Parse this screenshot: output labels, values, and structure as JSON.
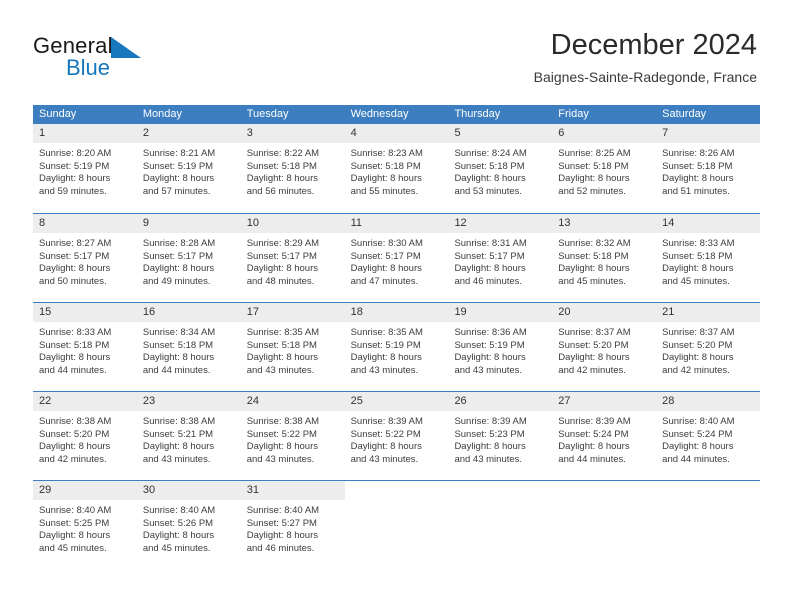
{
  "logo": {
    "word_one": "General",
    "word_two": "Blue",
    "mark": "triangle-icon",
    "color_dark": "#1a1a1a",
    "color_blue": "#1878be"
  },
  "header": {
    "title": "December 2024",
    "subtitle": "Baignes-Sainte-Radegonde, France"
  },
  "theme": {
    "header_blue": "#3c7ebf",
    "day_band_gray": "#ededed",
    "text": "#333333"
  },
  "weekday_headers": [
    "Sunday",
    "Monday",
    "Tuesday",
    "Wednesday",
    "Thursday",
    "Friday",
    "Saturday"
  ],
  "weeks": [
    [
      {
        "day": "1",
        "sunrise": "Sunrise: 8:20 AM",
        "sunset": "Sunset: 5:19 PM",
        "daylight_1": "Daylight: 8 hours",
        "daylight_2": "and 59 minutes."
      },
      {
        "day": "2",
        "sunrise": "Sunrise: 8:21 AM",
        "sunset": "Sunset: 5:19 PM",
        "daylight_1": "Daylight: 8 hours",
        "daylight_2": "and 57 minutes."
      },
      {
        "day": "3",
        "sunrise": "Sunrise: 8:22 AM",
        "sunset": "Sunset: 5:18 PM",
        "daylight_1": "Daylight: 8 hours",
        "daylight_2": "and 56 minutes."
      },
      {
        "day": "4",
        "sunrise": "Sunrise: 8:23 AM",
        "sunset": "Sunset: 5:18 PM",
        "daylight_1": "Daylight: 8 hours",
        "daylight_2": "and 55 minutes."
      },
      {
        "day": "5",
        "sunrise": "Sunrise: 8:24 AM",
        "sunset": "Sunset: 5:18 PM",
        "daylight_1": "Daylight: 8 hours",
        "daylight_2": "and 53 minutes."
      },
      {
        "day": "6",
        "sunrise": "Sunrise: 8:25 AM",
        "sunset": "Sunset: 5:18 PM",
        "daylight_1": "Daylight: 8 hours",
        "daylight_2": "and 52 minutes."
      },
      {
        "day": "7",
        "sunrise": "Sunrise: 8:26 AM",
        "sunset": "Sunset: 5:18 PM",
        "daylight_1": "Daylight: 8 hours",
        "daylight_2": "and 51 minutes."
      }
    ],
    [
      {
        "day": "8",
        "sunrise": "Sunrise: 8:27 AM",
        "sunset": "Sunset: 5:17 PM",
        "daylight_1": "Daylight: 8 hours",
        "daylight_2": "and 50 minutes."
      },
      {
        "day": "9",
        "sunrise": "Sunrise: 8:28 AM",
        "sunset": "Sunset: 5:17 PM",
        "daylight_1": "Daylight: 8 hours",
        "daylight_2": "and 49 minutes."
      },
      {
        "day": "10",
        "sunrise": "Sunrise: 8:29 AM",
        "sunset": "Sunset: 5:17 PM",
        "daylight_1": "Daylight: 8 hours",
        "daylight_2": "and 48 minutes."
      },
      {
        "day": "11",
        "sunrise": "Sunrise: 8:30 AM",
        "sunset": "Sunset: 5:17 PM",
        "daylight_1": "Daylight: 8 hours",
        "daylight_2": "and 47 minutes."
      },
      {
        "day": "12",
        "sunrise": "Sunrise: 8:31 AM",
        "sunset": "Sunset: 5:17 PM",
        "daylight_1": "Daylight: 8 hours",
        "daylight_2": "and 46 minutes."
      },
      {
        "day": "13",
        "sunrise": "Sunrise: 8:32 AM",
        "sunset": "Sunset: 5:18 PM",
        "daylight_1": "Daylight: 8 hours",
        "daylight_2": "and 45 minutes."
      },
      {
        "day": "14",
        "sunrise": "Sunrise: 8:33 AM",
        "sunset": "Sunset: 5:18 PM",
        "daylight_1": "Daylight: 8 hours",
        "daylight_2": "and 45 minutes."
      }
    ],
    [
      {
        "day": "15",
        "sunrise": "Sunrise: 8:33 AM",
        "sunset": "Sunset: 5:18 PM",
        "daylight_1": "Daylight: 8 hours",
        "daylight_2": "and 44 minutes."
      },
      {
        "day": "16",
        "sunrise": "Sunrise: 8:34 AM",
        "sunset": "Sunset: 5:18 PM",
        "daylight_1": "Daylight: 8 hours",
        "daylight_2": "and 44 minutes."
      },
      {
        "day": "17",
        "sunrise": "Sunrise: 8:35 AM",
        "sunset": "Sunset: 5:18 PM",
        "daylight_1": "Daylight: 8 hours",
        "daylight_2": "and 43 minutes."
      },
      {
        "day": "18",
        "sunrise": "Sunrise: 8:35 AM",
        "sunset": "Sunset: 5:19 PM",
        "daylight_1": "Daylight: 8 hours",
        "daylight_2": "and 43 minutes."
      },
      {
        "day": "19",
        "sunrise": "Sunrise: 8:36 AM",
        "sunset": "Sunset: 5:19 PM",
        "daylight_1": "Daylight: 8 hours",
        "daylight_2": "and 43 minutes."
      },
      {
        "day": "20",
        "sunrise": "Sunrise: 8:37 AM",
        "sunset": "Sunset: 5:20 PM",
        "daylight_1": "Daylight: 8 hours",
        "daylight_2": "and 42 minutes."
      },
      {
        "day": "21",
        "sunrise": "Sunrise: 8:37 AM",
        "sunset": "Sunset: 5:20 PM",
        "daylight_1": "Daylight: 8 hours",
        "daylight_2": "and 42 minutes."
      }
    ],
    [
      {
        "day": "22",
        "sunrise": "Sunrise: 8:38 AM",
        "sunset": "Sunset: 5:20 PM",
        "daylight_1": "Daylight: 8 hours",
        "daylight_2": "and 42 minutes."
      },
      {
        "day": "23",
        "sunrise": "Sunrise: 8:38 AM",
        "sunset": "Sunset: 5:21 PM",
        "daylight_1": "Daylight: 8 hours",
        "daylight_2": "and 43 minutes."
      },
      {
        "day": "24",
        "sunrise": "Sunrise: 8:38 AM",
        "sunset": "Sunset: 5:22 PM",
        "daylight_1": "Daylight: 8 hours",
        "daylight_2": "and 43 minutes."
      },
      {
        "day": "25",
        "sunrise": "Sunrise: 8:39 AM",
        "sunset": "Sunset: 5:22 PM",
        "daylight_1": "Daylight: 8 hours",
        "daylight_2": "and 43 minutes."
      },
      {
        "day": "26",
        "sunrise": "Sunrise: 8:39 AM",
        "sunset": "Sunset: 5:23 PM",
        "daylight_1": "Daylight: 8 hours",
        "daylight_2": "and 43 minutes."
      },
      {
        "day": "27",
        "sunrise": "Sunrise: 8:39 AM",
        "sunset": "Sunset: 5:24 PM",
        "daylight_1": "Daylight: 8 hours",
        "daylight_2": "and 44 minutes."
      },
      {
        "day": "28",
        "sunrise": "Sunrise: 8:40 AM",
        "sunset": "Sunset: 5:24 PM",
        "daylight_1": "Daylight: 8 hours",
        "daylight_2": "and 44 minutes."
      }
    ],
    [
      {
        "day": "29",
        "sunrise": "Sunrise: 8:40 AM",
        "sunset": "Sunset: 5:25 PM",
        "daylight_1": "Daylight: 8 hours",
        "daylight_2": "and 45 minutes."
      },
      {
        "day": "30",
        "sunrise": "Sunrise: 8:40 AM",
        "sunset": "Sunset: 5:26 PM",
        "daylight_1": "Daylight: 8 hours",
        "daylight_2": "and 45 minutes."
      },
      {
        "day": "31",
        "sunrise": "Sunrise: 8:40 AM",
        "sunset": "Sunset: 5:27 PM",
        "daylight_1": "Daylight: 8 hours",
        "daylight_2": "and 46 minutes."
      },
      {
        "day": "",
        "sunrise": "",
        "sunset": "",
        "daylight_1": "",
        "daylight_2": ""
      },
      {
        "day": "",
        "sunrise": "",
        "sunset": "",
        "daylight_1": "",
        "daylight_2": ""
      },
      {
        "day": "",
        "sunrise": "",
        "sunset": "",
        "daylight_1": "",
        "daylight_2": ""
      },
      {
        "day": "",
        "sunrise": "",
        "sunset": "",
        "daylight_1": "",
        "daylight_2": ""
      }
    ]
  ]
}
